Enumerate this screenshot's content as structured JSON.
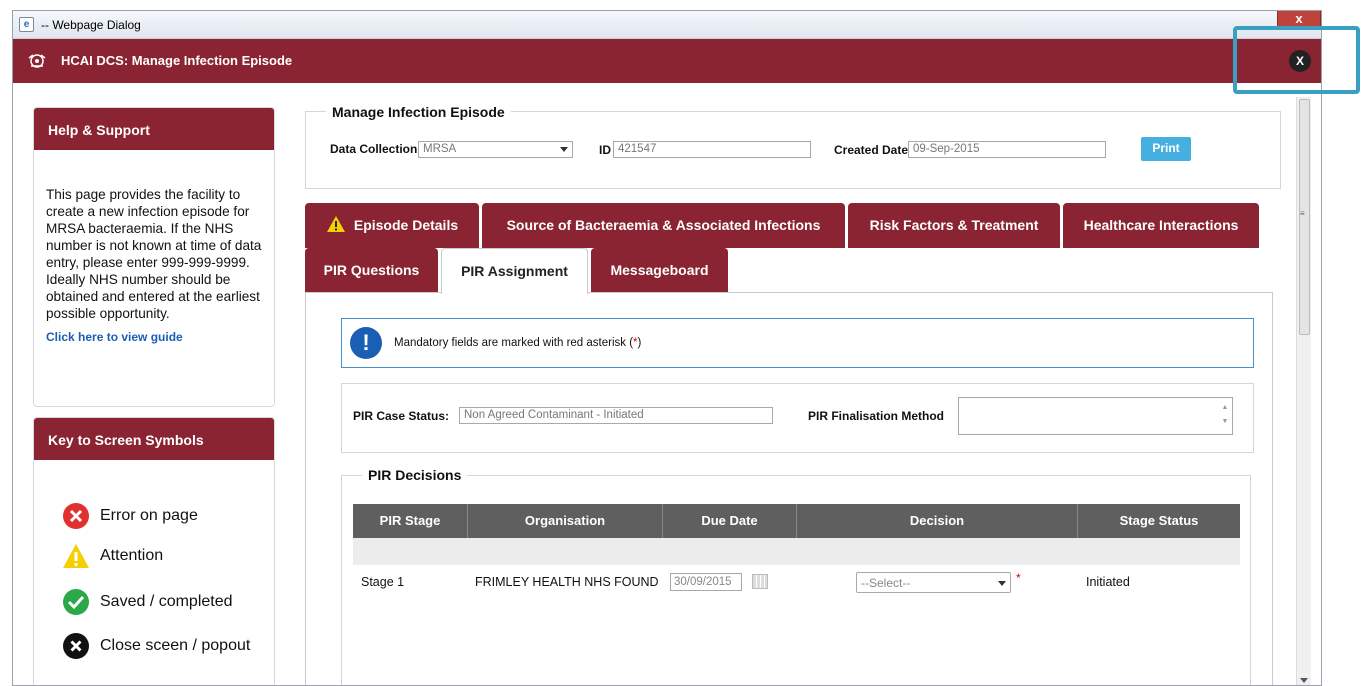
{
  "window": {
    "title": "-- Webpage Dialog",
    "close_glyph": "x"
  },
  "app": {
    "title": "HCAI DCS: Manage Infection Episode",
    "close_glyph": "X",
    "brand_color": "#8a2432"
  },
  "help": {
    "title": "Help & Support",
    "text": "This page provides the facility to create a new infection episode for MRSA bacteraemia. If the NHS number is not known at time of data entry, please enter 999-999-9999. Ideally NHS number should be obtained and entered at the earliest possible opportunity.",
    "guide_link": "Click here to view guide"
  },
  "key": {
    "title": "Key to Screen Symbols",
    "items": [
      {
        "icon": "error-icon",
        "label": "Error on page",
        "color": "#e03030"
      },
      {
        "icon": "attention-icon",
        "label": "Attention",
        "color": "#f5d000"
      },
      {
        "icon": "saved-icon",
        "label": "Saved / completed",
        "color": "#2aa84a"
      },
      {
        "icon": "close-icon",
        "label": "Close sceen / popout",
        "color": "#111111"
      }
    ]
  },
  "episode": {
    "legend": "Manage Infection Episode",
    "data_collection_label": "Data Collection",
    "data_collection_value": "MRSA",
    "id_label": "ID",
    "id_value": "421547",
    "created_label": "Created Date",
    "created_value": "09-Sep-2015",
    "print_label": "Print"
  },
  "tabs_row1": [
    "Episode Details",
    "Source of Bacteraemia & Associated Infections",
    "Risk Factors & Treatment",
    "Healthcare Interactions"
  ],
  "tabs_row2": [
    "PIR Questions",
    "PIR Assignment",
    "Messageboard"
  ],
  "active_tab": "PIR Assignment",
  "info": {
    "text": "Mandatory fields are marked with red asterisk (",
    "star": "*",
    "close": ")"
  },
  "pir": {
    "case_status_label": "PIR Case Status:",
    "case_status_value": "Non Agreed Contaminant - Initiated",
    "finalisation_label": "PIR Finalisation Method",
    "finalisation_value": ""
  },
  "decisions": {
    "legend": "PIR Decisions",
    "columns": [
      "PIR Stage",
      "Organisation",
      "Due Date",
      "Decision",
      "Stage Status"
    ],
    "rows": [
      {
        "stage": "Stage 1",
        "organisation": "FRIMLEY HEALTH NHS FOUND",
        "due_date": "30/09/2015",
        "decision": "--Select--",
        "required": "*",
        "status": "Initiated"
      }
    ]
  }
}
